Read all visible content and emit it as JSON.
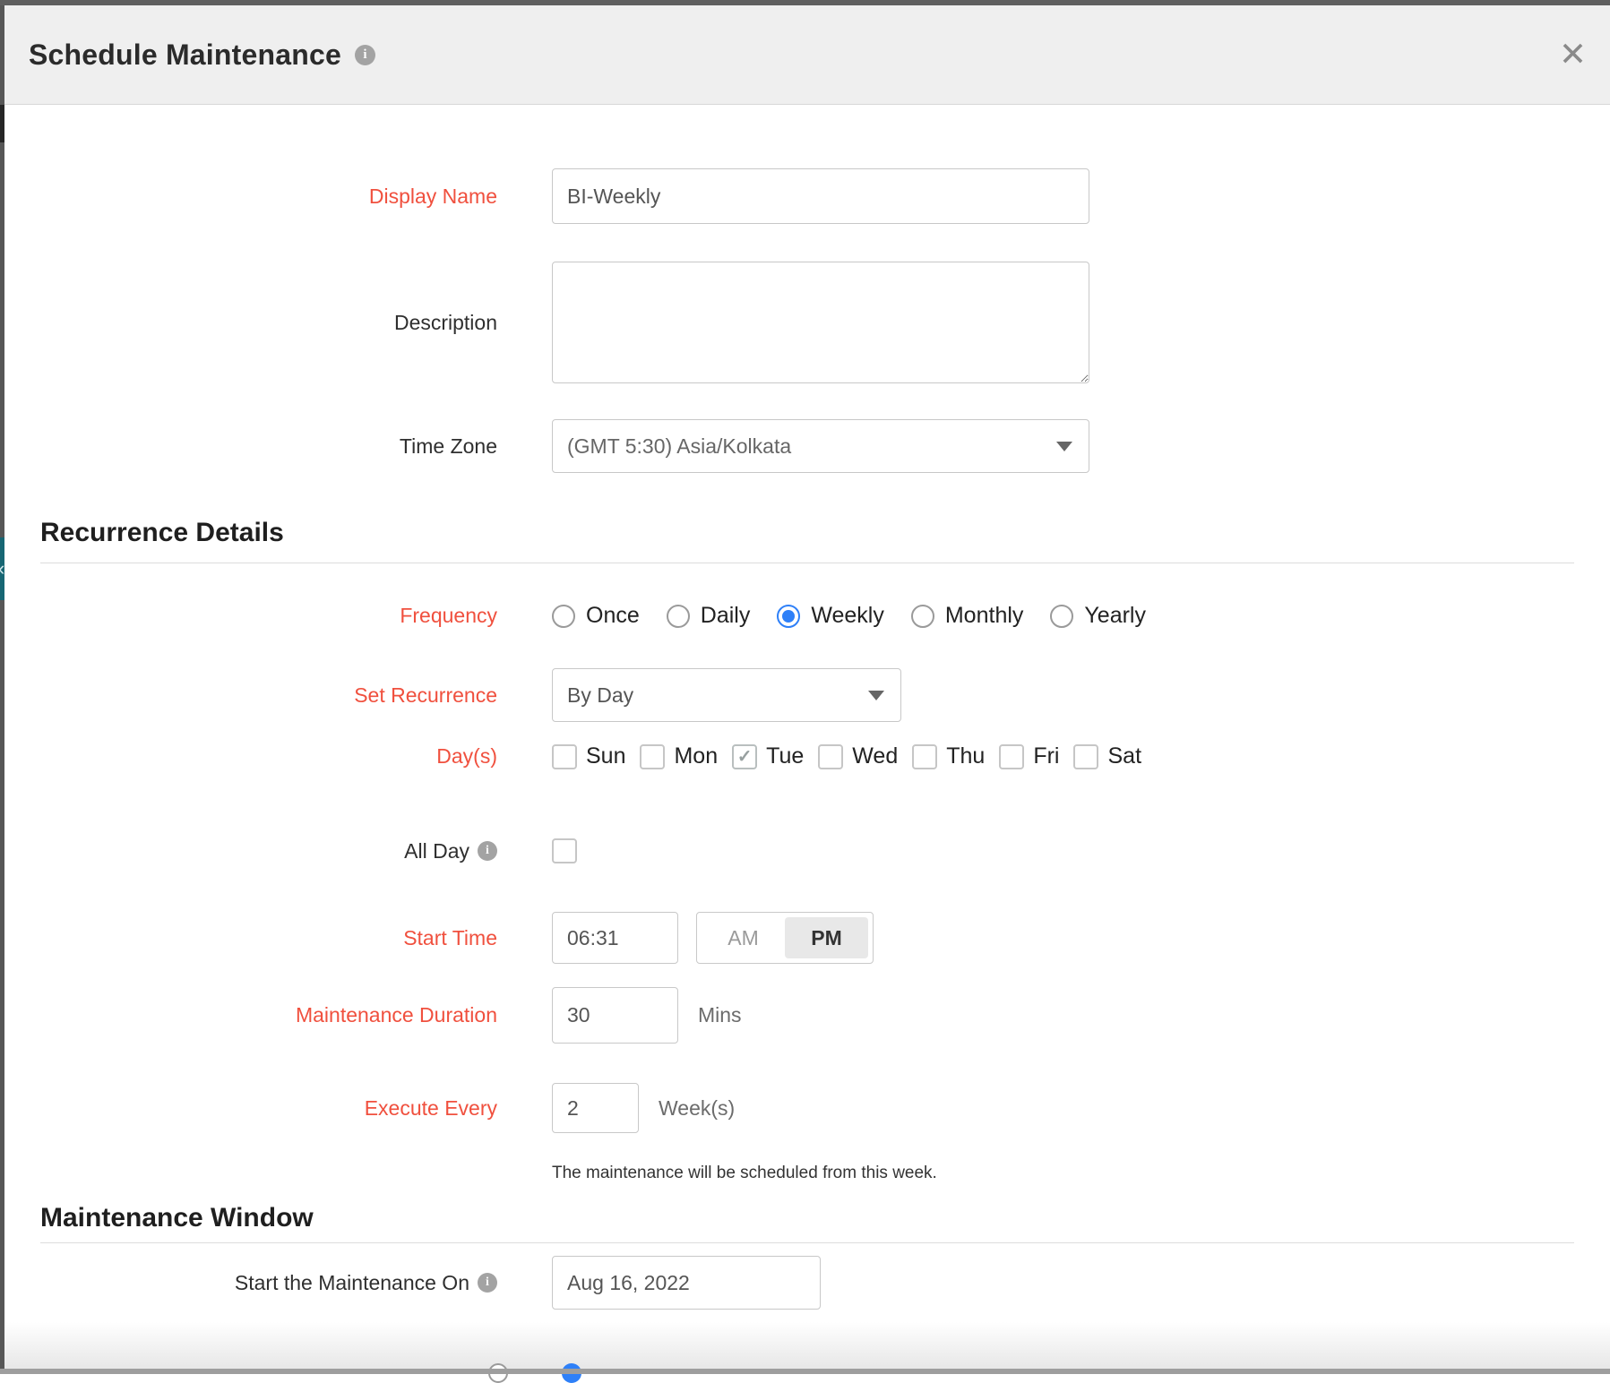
{
  "dialog": {
    "title": "Schedule Maintenance"
  },
  "icons": {
    "close": "✕",
    "info": "i",
    "check": "✓",
    "back": "‹"
  },
  "colors": {
    "required_label": "#f0503e",
    "selected_radio": "#2e80f8",
    "header_bg": "#efefef"
  },
  "fields": {
    "display_name": {
      "label": "Display Name",
      "value": "BI-Weekly",
      "required": true
    },
    "description": {
      "label": "Description",
      "value": ""
    },
    "time_zone": {
      "label": "Time Zone",
      "value": "(GMT 5:30) Asia/Kolkata"
    }
  },
  "sections": {
    "recurrence": {
      "title": "Recurrence Details"
    },
    "maintenance_window": {
      "title": "Maintenance Window"
    }
  },
  "frequency": {
    "label": "Frequency",
    "options": [
      {
        "label": "Once",
        "selected": false
      },
      {
        "label": "Daily",
        "selected": false
      },
      {
        "label": "Weekly",
        "selected": true
      },
      {
        "label": "Monthly",
        "selected": false
      },
      {
        "label": "Yearly",
        "selected": false
      }
    ]
  },
  "set_recurrence": {
    "label": "Set Recurrence",
    "value": "By Day"
  },
  "days": {
    "label": "Day(s)",
    "options": [
      {
        "label": "Sun",
        "checked": false
      },
      {
        "label": "Mon",
        "checked": false
      },
      {
        "label": "Tue",
        "checked": true
      },
      {
        "label": "Wed",
        "checked": false
      },
      {
        "label": "Thu",
        "checked": false
      },
      {
        "label": "Fri",
        "checked": false
      },
      {
        "label": "Sat",
        "checked": false
      }
    ]
  },
  "all_day": {
    "label": "All Day",
    "checked": false
  },
  "start_time": {
    "label": "Start Time",
    "value": "06:31",
    "meridiem": {
      "am": "AM",
      "pm": "PM",
      "selected": "PM",
      "pm_selected": true
    }
  },
  "maintenance_duration": {
    "label": "Maintenance Duration",
    "value": "30",
    "unit": "Mins"
  },
  "execute_every": {
    "label": "Execute Every",
    "value": "2",
    "unit": "Week(s)",
    "note": "The maintenance will be scheduled from this week."
  },
  "start_on": {
    "label": "Start the Maintenance On",
    "value": "Aug 16, 2022"
  }
}
